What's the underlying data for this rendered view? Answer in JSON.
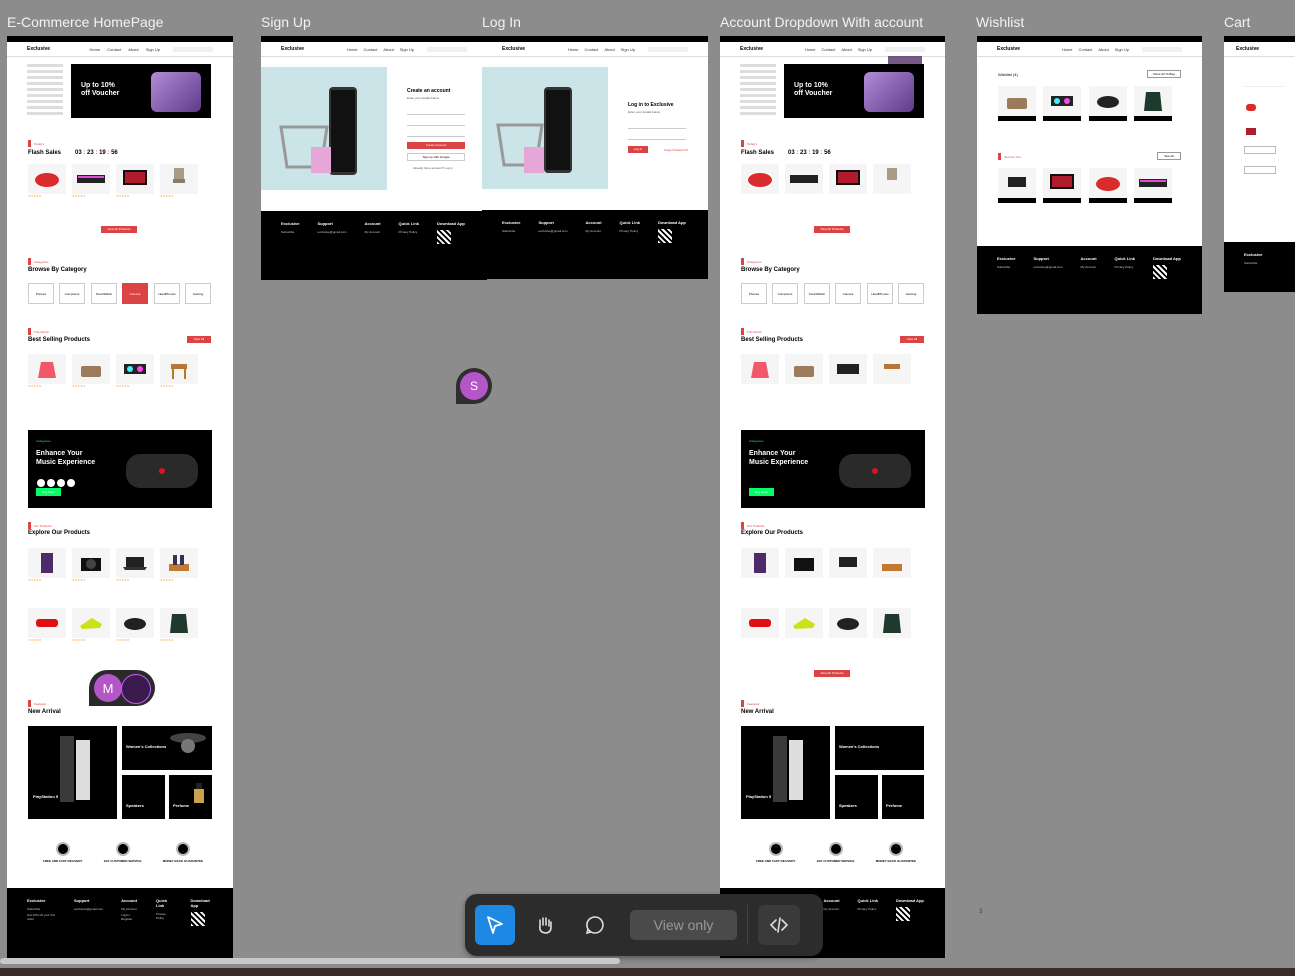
{
  "frames": {
    "home": "E-Commerce HomePage",
    "signup": "Sign Up",
    "login": "Log In",
    "account": "Account Dropdown With account",
    "wishlist": "Wishlist",
    "cart": "Cart"
  },
  "site": {
    "logo": "Exclusive",
    "nav": [
      "Home",
      "Contact",
      "About",
      "Sign Up"
    ],
    "hero_line1": "Up to 10%",
    "hero_line2": "off Voucher",
    "flash_tag": "Today's",
    "flash_title": "Flash Sales",
    "timer": [
      "03",
      "23",
      "19",
      "56"
    ],
    "view_all": "View All Products",
    "cat_tag": "Categories",
    "cat_title": "Browse By Category",
    "categories": [
      "Phones",
      "Computers",
      "SmartWatch",
      "Camera",
      "HeadPhones",
      "Gaming"
    ],
    "best_tag": "This Month",
    "best_title": "Best Selling Products",
    "view_btn": "View All",
    "music_tag": "Categories",
    "music_line1": "Enhance Your",
    "music_line2": "Music Experience",
    "buy_now": "Buy Now!",
    "explore_tag": "Our Products",
    "explore_title": "Explore Our Products",
    "arrival_tag": "Featured",
    "arrival_title": "New Arrival",
    "arrival": [
      "PlayStation 5",
      "Women's Collections",
      "Speakers",
      "Perfume"
    ],
    "services": [
      "FREE AND FAST DELIVERY",
      "24/7 CUSTOMER SERVICE",
      "MONEY BACK GUARANTEE"
    ],
    "footer": {
      "c1": [
        "Exclusive",
        "Subscribe",
        "Get 10% off your first order"
      ],
      "c2": [
        "Support",
        "111 Bijoy sarani, Dhaka, DH 1515, Bangladesh.",
        "exclusive@gmail.com",
        "+88015-88888-9999"
      ],
      "c3": [
        "Account",
        "My Account",
        "Login / Register",
        "Cart",
        "Wishlist",
        "Shop"
      ],
      "c4": [
        "Quick Link",
        "Privacy Policy",
        "Terms Of Use",
        "FAQ",
        "Contact"
      ],
      "c5": [
        "Download App"
      ]
    }
  },
  "signup": {
    "title": "Create an account",
    "sub": "Enter your details below",
    "btn": "Create Account",
    "google": "Sign up with Google",
    "have": "Already have account?  Log in"
  },
  "login": {
    "title": "Log in to Exclusive",
    "sub": "Enter your details below",
    "btn": "Log In",
    "forgot": "Forget Password?"
  },
  "wishlist": {
    "title": "Wishlist (4)",
    "move": "Move All To Bag",
    "just": "Just For You",
    "see": "See All"
  },
  "canvas": {
    "avatar_s": "S",
    "avatar_m": "M",
    "view_only": "View only",
    "stray": "3"
  }
}
